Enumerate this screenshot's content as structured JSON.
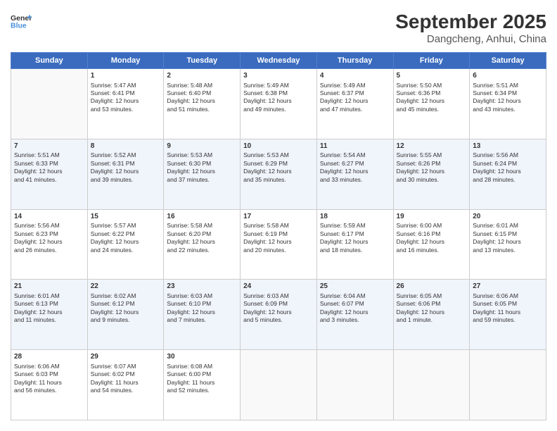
{
  "header": {
    "logo_line1": "General",
    "logo_line2": "Blue",
    "title": "September 2025",
    "subtitle": "Dangcheng, Anhui, China"
  },
  "weekdays": [
    "Sunday",
    "Monday",
    "Tuesday",
    "Wednesday",
    "Thursday",
    "Friday",
    "Saturday"
  ],
  "weeks": [
    [
      {
        "day": "",
        "content": ""
      },
      {
        "day": "1",
        "content": "Sunrise: 5:47 AM\nSunset: 6:41 PM\nDaylight: 12 hours\nand 53 minutes."
      },
      {
        "day": "2",
        "content": "Sunrise: 5:48 AM\nSunset: 6:40 PM\nDaylight: 12 hours\nand 51 minutes."
      },
      {
        "day": "3",
        "content": "Sunrise: 5:49 AM\nSunset: 6:38 PM\nDaylight: 12 hours\nand 49 minutes."
      },
      {
        "day": "4",
        "content": "Sunrise: 5:49 AM\nSunset: 6:37 PM\nDaylight: 12 hours\nand 47 minutes."
      },
      {
        "day": "5",
        "content": "Sunrise: 5:50 AM\nSunset: 6:36 PM\nDaylight: 12 hours\nand 45 minutes."
      },
      {
        "day": "6",
        "content": "Sunrise: 5:51 AM\nSunset: 6:34 PM\nDaylight: 12 hours\nand 43 minutes."
      }
    ],
    [
      {
        "day": "7",
        "content": "Sunrise: 5:51 AM\nSunset: 6:33 PM\nDaylight: 12 hours\nand 41 minutes."
      },
      {
        "day": "8",
        "content": "Sunrise: 5:52 AM\nSunset: 6:31 PM\nDaylight: 12 hours\nand 39 minutes."
      },
      {
        "day": "9",
        "content": "Sunrise: 5:53 AM\nSunset: 6:30 PM\nDaylight: 12 hours\nand 37 minutes."
      },
      {
        "day": "10",
        "content": "Sunrise: 5:53 AM\nSunset: 6:29 PM\nDaylight: 12 hours\nand 35 minutes."
      },
      {
        "day": "11",
        "content": "Sunrise: 5:54 AM\nSunset: 6:27 PM\nDaylight: 12 hours\nand 33 minutes."
      },
      {
        "day": "12",
        "content": "Sunrise: 5:55 AM\nSunset: 6:26 PM\nDaylight: 12 hours\nand 30 minutes."
      },
      {
        "day": "13",
        "content": "Sunrise: 5:56 AM\nSunset: 6:24 PM\nDaylight: 12 hours\nand 28 minutes."
      }
    ],
    [
      {
        "day": "14",
        "content": "Sunrise: 5:56 AM\nSunset: 6:23 PM\nDaylight: 12 hours\nand 26 minutes."
      },
      {
        "day": "15",
        "content": "Sunrise: 5:57 AM\nSunset: 6:22 PM\nDaylight: 12 hours\nand 24 minutes."
      },
      {
        "day": "16",
        "content": "Sunrise: 5:58 AM\nSunset: 6:20 PM\nDaylight: 12 hours\nand 22 minutes."
      },
      {
        "day": "17",
        "content": "Sunrise: 5:58 AM\nSunset: 6:19 PM\nDaylight: 12 hours\nand 20 minutes."
      },
      {
        "day": "18",
        "content": "Sunrise: 5:59 AM\nSunset: 6:17 PM\nDaylight: 12 hours\nand 18 minutes."
      },
      {
        "day": "19",
        "content": "Sunrise: 6:00 AM\nSunset: 6:16 PM\nDaylight: 12 hours\nand 16 minutes."
      },
      {
        "day": "20",
        "content": "Sunrise: 6:01 AM\nSunset: 6:15 PM\nDaylight: 12 hours\nand 13 minutes."
      }
    ],
    [
      {
        "day": "21",
        "content": "Sunrise: 6:01 AM\nSunset: 6:13 PM\nDaylight: 12 hours\nand 11 minutes."
      },
      {
        "day": "22",
        "content": "Sunrise: 6:02 AM\nSunset: 6:12 PM\nDaylight: 12 hours\nand 9 minutes."
      },
      {
        "day": "23",
        "content": "Sunrise: 6:03 AM\nSunset: 6:10 PM\nDaylight: 12 hours\nand 7 minutes."
      },
      {
        "day": "24",
        "content": "Sunrise: 6:03 AM\nSunset: 6:09 PM\nDaylight: 12 hours\nand 5 minutes."
      },
      {
        "day": "25",
        "content": "Sunrise: 6:04 AM\nSunset: 6:07 PM\nDaylight: 12 hours\nand 3 minutes."
      },
      {
        "day": "26",
        "content": "Sunrise: 6:05 AM\nSunset: 6:06 PM\nDaylight: 12 hours\nand 1 minute."
      },
      {
        "day": "27",
        "content": "Sunrise: 6:06 AM\nSunset: 6:05 PM\nDaylight: 11 hours\nand 59 minutes."
      }
    ],
    [
      {
        "day": "28",
        "content": "Sunrise: 6:06 AM\nSunset: 6:03 PM\nDaylight: 11 hours\nand 56 minutes."
      },
      {
        "day": "29",
        "content": "Sunrise: 6:07 AM\nSunset: 6:02 PM\nDaylight: 11 hours\nand 54 minutes."
      },
      {
        "day": "30",
        "content": "Sunrise: 6:08 AM\nSunset: 6:00 PM\nDaylight: 11 hours\nand 52 minutes."
      },
      {
        "day": "",
        "content": ""
      },
      {
        "day": "",
        "content": ""
      },
      {
        "day": "",
        "content": ""
      },
      {
        "day": "",
        "content": ""
      }
    ]
  ]
}
